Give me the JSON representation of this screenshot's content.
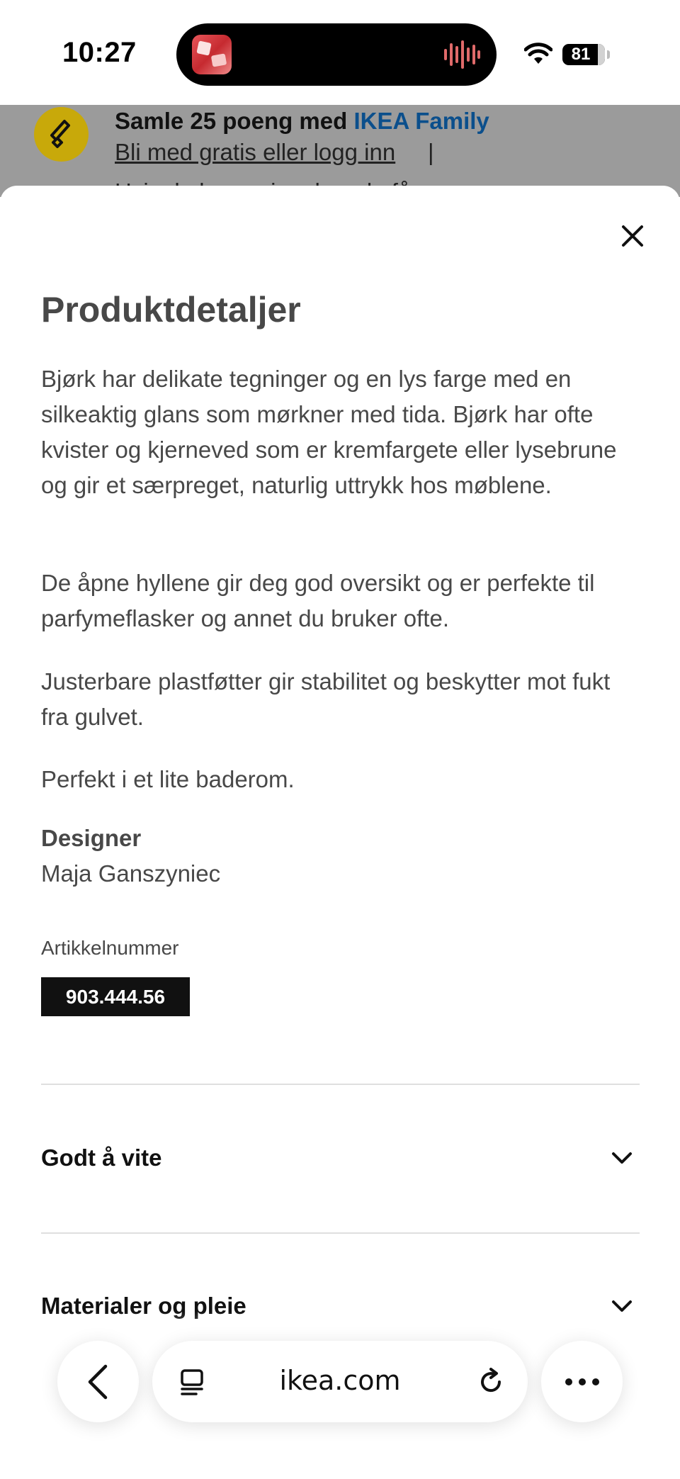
{
  "status_bar": {
    "time": "10:27",
    "battery": "81"
  },
  "background_banner": {
    "title_prefix": "Samle 25 poeng med ",
    "title_brand": "IKEA Family",
    "link": "Bli med gratis eller logg inn",
    "separator": "|",
    "partial_line": "Hvis du logger inn, kan du få"
  },
  "sheet": {
    "title": "Produktdetaljer",
    "paragraphs": [
      "Bjørk har delikate tegninger og en lys farge med en silkeaktig glans som mørkner med tida. Bjørk har ofte kvister og kjerneved som er kremfargete eller lysebrune og gir et særpreget, naturlig uttrykk hos møblene.",
      "De åpne hyllene gir deg god oversikt og er perfekte til parfymeflasker og annet du bruker ofte.",
      "Justerbare plastføtter gir stabilitet og beskytter mot fukt fra gulvet.",
      "Perfekt i et lite baderom."
    ],
    "designer_label": "Designer",
    "designer_name": "Maja Ganszyniec",
    "article_label": "Artikkelnummer",
    "article_number": "903.444.56",
    "accordions": [
      {
        "label": "Godt å vite"
      },
      {
        "label": "Materialer og pleie"
      }
    ]
  },
  "browser": {
    "address": "ikea.com"
  },
  "colors": {
    "text": "#484848",
    "brand_link": "#0b4f8c",
    "family_badge": "#c8a90a",
    "article_bg": "#111111",
    "divider": "#dfdfdf"
  },
  "icons": [
    "close-icon",
    "chevron-down-icon",
    "back-icon",
    "reader-icon",
    "reload-icon",
    "more-icon",
    "wifi-icon",
    "battery-icon"
  ]
}
